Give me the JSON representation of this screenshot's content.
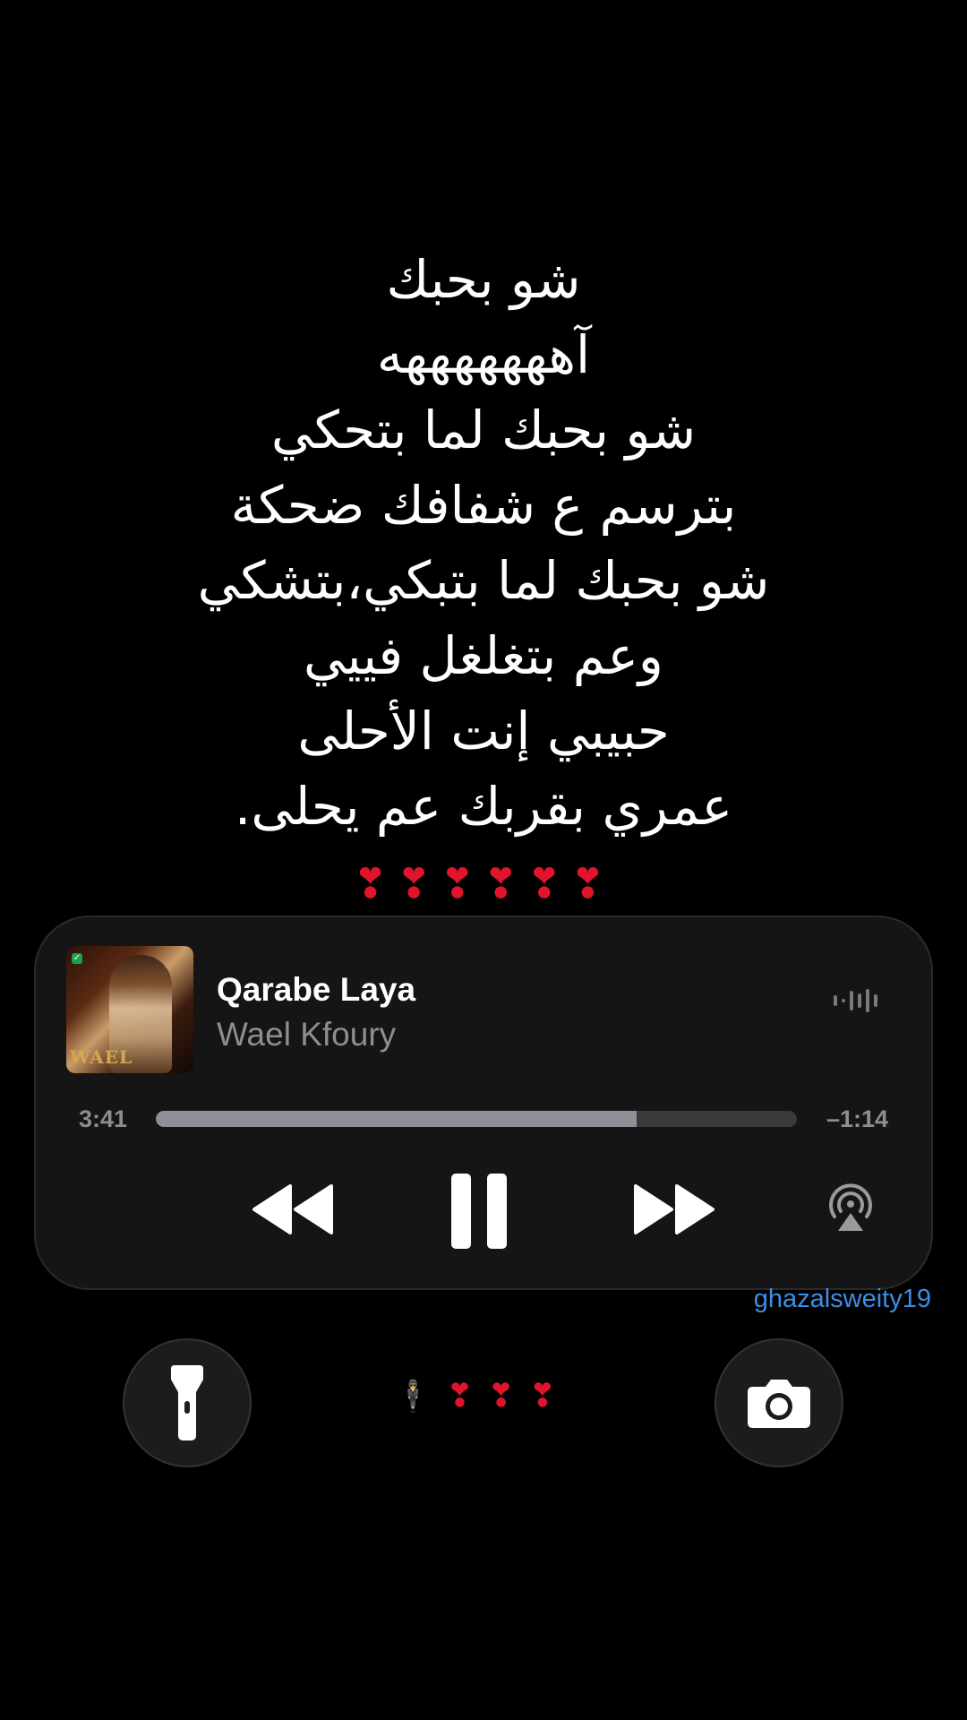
{
  "lyrics": {
    "lines": [
      "شو بحبك",
      "آهههههههه",
      "شو بحبك لما بتحكي",
      "بترسم ع شفافك ضحكة",
      "شو بحبك لما بتبكي،بتشكي",
      "وعم بتغلغل فييي",
      "حبيبي إنت الأحلى",
      "عمري بقربك عم يحلى."
    ],
    "hearts": "❣❣❣❣❣❣"
  },
  "player": {
    "title": "Qarabe Laya",
    "artist": "Wael Kfoury",
    "artwork_caption": "WAEL",
    "elapsed": "3:41",
    "remaining": "–1:14",
    "progress": 0.75,
    "colors": {
      "background": "#151515",
      "progress_fill": "#8f8f95",
      "progress_track": "#3a3a3a",
      "secondary_text": "#8e8e8e"
    }
  },
  "watermark": "ghazalsweity19",
  "bottom": {
    "emoji_person": "🕴",
    "hearts": [
      "❣",
      "❣",
      "❣"
    ],
    "heart_color": "#e0142b",
    "flashlight_icon": "flashlight-icon",
    "camera_icon": "camera-icon"
  }
}
